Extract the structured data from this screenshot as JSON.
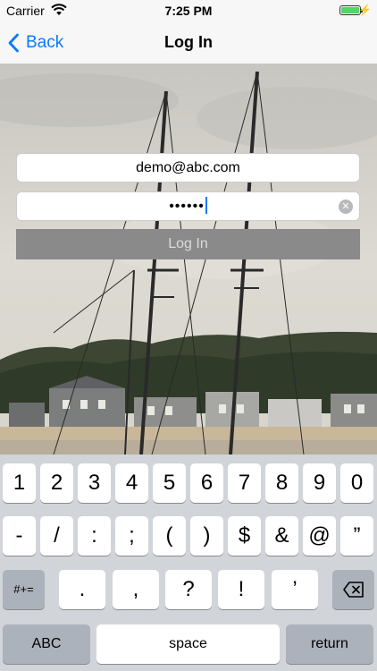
{
  "status_bar": {
    "carrier": "Carrier",
    "time": "7:25 PM",
    "battery_level": 1.0,
    "icons": [
      "wifi-icon",
      "battery-icon",
      "charging-bolt-icon"
    ]
  },
  "nav": {
    "back_label": "Back",
    "title": "Log In"
  },
  "form": {
    "email_value": "demo@abc.com",
    "password_masked": "••••••",
    "login_label": "Log In"
  },
  "keyboard": {
    "row1": [
      "1",
      "2",
      "3",
      "4",
      "5",
      "6",
      "7",
      "8",
      "9",
      "0"
    ],
    "row2": [
      "-",
      "/",
      ":",
      ";",
      "(",
      ")",
      "$",
      "&",
      "@",
      "”"
    ],
    "row3": [
      "#+=",
      ".",
      ",",
      "?",
      "!",
      "’"
    ],
    "abc": "ABC",
    "space": "space",
    "return": "return"
  },
  "colors": {
    "accent": "#0a7aff",
    "login_button": "#8a8a8a",
    "keyboard_bg": "#d1d4d9"
  }
}
